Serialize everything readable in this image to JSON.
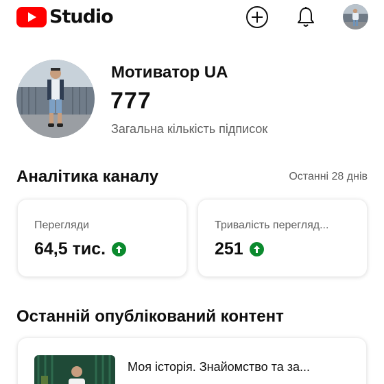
{
  "header": {
    "brand": "Studio",
    "icons": [
      "youtube-logo-icon",
      "create-plus-icon",
      "bell-icon",
      "account-avatar"
    ],
    "brand_color": "#ff0000"
  },
  "channel": {
    "name": "Мотиватор UA",
    "subscribers": "777",
    "subscribers_label": "Загальна кількість підписок"
  },
  "analytics": {
    "title": "Аналітика каналу",
    "period": "Останні 28 днів",
    "metrics": [
      {
        "label": "Перегляди",
        "value": "64,5 тис.",
        "trend": "up"
      },
      {
        "label": "Тривалість перегляд...",
        "value": "251",
        "trend": "up"
      }
    ],
    "trend_color": "#0b8a2e"
  },
  "latest_content": {
    "title": "Останній опублікований контент",
    "video_title": "Моя історія. Знайомство та за..."
  }
}
